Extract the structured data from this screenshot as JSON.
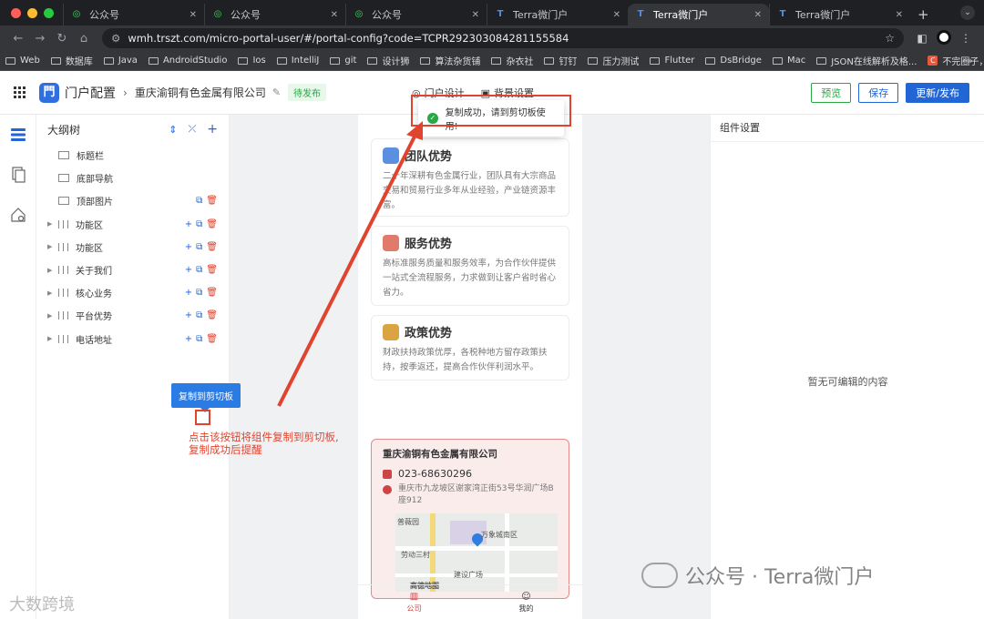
{
  "browser": {
    "tabs": [
      {
        "label": "公众号",
        "active": false
      },
      {
        "label": "公众号",
        "active": false
      },
      {
        "label": "公众号",
        "active": false
      },
      {
        "label": "Terra微门户",
        "active": false
      },
      {
        "label": "Terra微门户",
        "active": true
      },
      {
        "label": "Terra微门户",
        "active": false
      }
    ],
    "url": "wmh.trszt.com/micro-portal-user/#/portal-config?code=TCPR292303084281155584",
    "bookmarks": [
      "Web",
      "数据库",
      "Java",
      "AndroidStudio",
      "Ios",
      "IntelliJ",
      "git",
      "设计狮",
      "算法杂货铺",
      "杂衣社",
      "钉钉",
      "压力测试",
      "Flutter",
      "DsBridge",
      "Mac",
      "JSON在线解析及格...",
      "不完圈子，App可..."
    ],
    "more": "»"
  },
  "header": {
    "title": "门户配置",
    "company": "重庆渝铜有色金属有限公司",
    "status": "待发布",
    "center_tabs": [
      "门户设计",
      "背景设置"
    ],
    "buttons": {
      "preview": "预览",
      "save": "保存",
      "publish": "更新/发布"
    }
  },
  "toast": {
    "message": "复制成功，请到剪切板使用!"
  },
  "outline": {
    "title": "大纲树",
    "items": [
      {
        "label": "标题栏",
        "expandable": false,
        "icon": "image-icon",
        "actions": []
      },
      {
        "label": "底部导航",
        "expandable": false,
        "icon": "nav-icon",
        "actions": []
      },
      {
        "label": "顶部图片",
        "expandable": false,
        "icon": "image-icon",
        "actions": [
          "copy",
          "delete"
        ]
      },
      {
        "label": "功能区",
        "expandable": true,
        "icon": "columns-icon",
        "actions": [
          "add",
          "copy",
          "delete"
        ]
      },
      {
        "label": "功能区",
        "expandable": true,
        "icon": "columns-icon",
        "actions": [
          "add",
          "copy",
          "delete"
        ]
      },
      {
        "label": "关于我们",
        "expandable": true,
        "icon": "columns-icon",
        "actions": [
          "add",
          "copy",
          "delete"
        ]
      },
      {
        "label": "核心业务",
        "expandable": true,
        "icon": "columns-icon",
        "actions": [
          "add",
          "copy",
          "delete"
        ]
      },
      {
        "label": "平台优势",
        "expandable": true,
        "icon": "columns-icon",
        "actions": [
          "add",
          "copy",
          "delete"
        ]
      },
      {
        "label": "电话地址",
        "expandable": true,
        "icon": "columns-icon",
        "actions": [
          "add",
          "copy",
          "delete"
        ]
      }
    ],
    "tooltip": "复制到剪切板"
  },
  "annotation": {
    "line1": "点击该按钮将组件复制到剪切板,",
    "line2": "复制成功后提醒"
  },
  "preview": {
    "cards": [
      {
        "title": "团队优势",
        "desc": "二十年深耕有色金属行业，团队具有大宗商品交易和贸易行业多年从业经验，产业链资源丰富。",
        "color": "#5b8fe0"
      },
      {
        "title": "服务优势",
        "desc": "高标准服务质量和服务效率，为合作伙伴提供一站式全流程服务，力求做到让客户省时省心省力。",
        "color": "#e07a6a"
      },
      {
        "title": "政策优势",
        "desc": "财政扶持政策优厚，各税种地方留存政策扶持，按季返还，提高合作伙伴利润水平。",
        "color": "#d9a441"
      }
    ],
    "contact": {
      "company": "重庆渝铜有色金属有限公司",
      "phone": "023-68630296",
      "address": "重庆市九龙坡区谢家湾正街53号华润广场B座912",
      "map_labels": [
        "普薇园",
        "万象城南区",
        "劳动三村",
        "建设广场",
        "高德地图"
      ]
    },
    "nav": [
      {
        "label": "公司",
        "active": true
      },
      {
        "label": "我的",
        "active": false
      }
    ]
  },
  "settings": {
    "title": "组件设置",
    "empty": "暂无可编辑的内容"
  },
  "watermarks": {
    "main": "公众号 · Terra微门户",
    "bottom_left": "大数跨境"
  },
  "colors": {
    "primary": "#2266d6",
    "success": "#28a745",
    "danger": "#e0442f"
  }
}
